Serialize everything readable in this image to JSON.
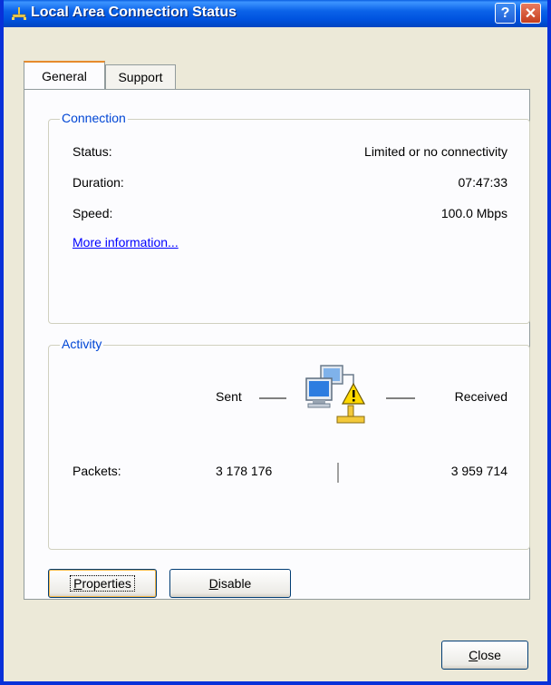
{
  "window": {
    "title": "Local Area Connection Status",
    "help_label": "?",
    "close_label": "✕"
  },
  "tabs": [
    {
      "label": "General"
    },
    {
      "label": "Support"
    }
  ],
  "connection": {
    "group_title": "Connection",
    "status_label": "Status:",
    "status_value": "Limited or no connectivity",
    "duration_label": "Duration:",
    "duration_value": "07:47:33",
    "speed_label": "Speed:",
    "speed_value": "100.0 Mbps",
    "more_info": "More information..."
  },
  "activity": {
    "group_title": "Activity",
    "sent_label": "Sent",
    "received_label": "Received",
    "packets_label": "Packets:",
    "packets_sent": "3 178 176",
    "packets_received": "3 959 714",
    "icon": "network-warning-icon"
  },
  "buttons": {
    "properties_mnemonic": "P",
    "properties_rest": "roperties",
    "disable_mnemonic": "D",
    "disable_rest": "isable",
    "close_mnemonic": "C",
    "close_rest": "lose"
  },
  "colors": {
    "title_bar": "#0053e0",
    "group_title": "#0046d5",
    "link": "#0000ff"
  }
}
